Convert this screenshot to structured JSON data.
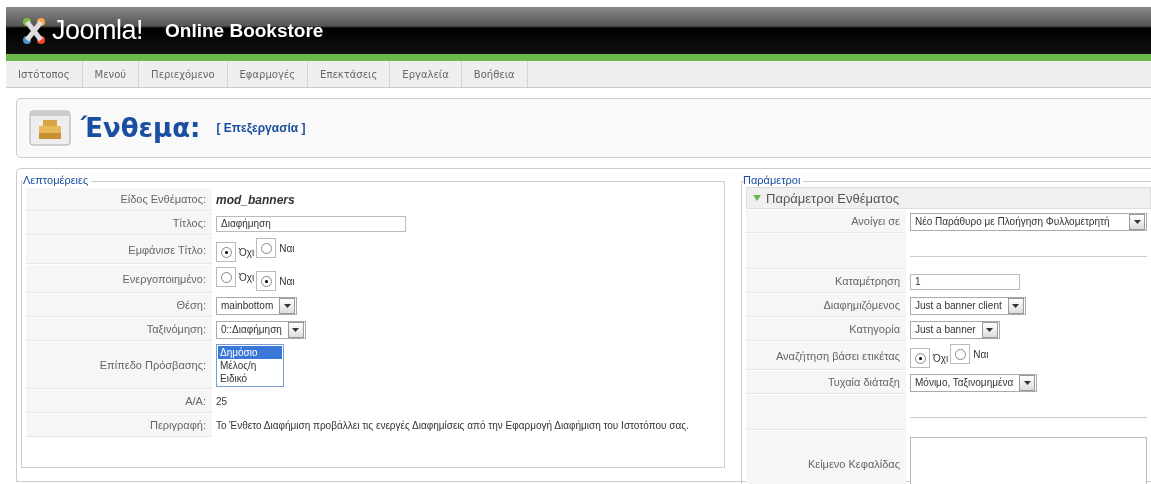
{
  "header": {
    "logo_text": "Joomla!",
    "site_name": "Online Bookstore"
  },
  "menu": [
    {
      "label": "Ιστότοπος"
    },
    {
      "label": "Μενού"
    },
    {
      "label": "Περιεχόμενο"
    },
    {
      "label": "Εφαρμογές"
    },
    {
      "label": "Επεκτάσεις"
    },
    {
      "label": "Εργαλεία"
    },
    {
      "label": "Βοήθεια"
    }
  ],
  "page_title": {
    "title": "Ένθεμα:",
    "subtitle": "[ Επεξεργασία ]"
  },
  "details": {
    "legend": "Λεπτομέρειες",
    "rows": [
      {
        "kind": "static",
        "label": "Είδος Ενθέματος:",
        "value": "mod_banners"
      },
      {
        "kind": "text",
        "label": "Τίτλος:",
        "value": "Διαφήμηση"
      },
      {
        "kind": "radio",
        "label": "Εμφάνισε Τίτλο:",
        "options": [
          {
            "label": "Όχι",
            "selected": true
          },
          {
            "label": "Ναι",
            "selected": false
          }
        ]
      },
      {
        "kind": "radio",
        "label": "Ενεργοποιημένο:",
        "options": [
          {
            "label": "Όχι",
            "selected": false
          },
          {
            "label": "Ναι",
            "selected": true
          }
        ]
      },
      {
        "kind": "select",
        "label": "Θέση:",
        "value": "mainbottom"
      },
      {
        "kind": "select",
        "label": "Ταξινόμηση:",
        "value": "0::Διαφήμηση"
      },
      {
        "kind": "list",
        "label": "Επίπεδο Πρόσβασης:",
        "options": [
          {
            "label": "Δημόσιο",
            "selected": true
          },
          {
            "label": "Μέλος/η",
            "selected": false
          },
          {
            "label": "Ειδικό",
            "selected": false
          }
        ]
      },
      {
        "kind": "plain",
        "label": "Α/Α:",
        "value": "25"
      },
      {
        "kind": "plain",
        "label": "Περιγραφή:",
        "value": "Το Ένθετο Διαφήμιση προβάλλει τις ενεργές Διαφημίσεις από την Εφαρμογή Διαφήμιση του Ιστοτόπου σας."
      }
    ]
  },
  "parameters": {
    "legend": "Παράμετροι",
    "panel_title": "Παράμετροι Ενθέματος",
    "expanded": true,
    "rows": [
      {
        "kind": "select",
        "label": "Ανοίγει σε",
        "value": "Νέο Παράθυρο με Πλοήγηση Φυλλομετρητή"
      },
      {
        "kind": "separator"
      },
      {
        "kind": "text",
        "label": "Καταμέτρηση",
        "value": "1"
      },
      {
        "kind": "select",
        "label": "Διαφημιζόμενος",
        "value": "Just a banner client"
      },
      {
        "kind": "select",
        "label": "Κατηγορία",
        "value": "Just a banner"
      },
      {
        "kind": "radio",
        "label": "Αναζήτηση βάσει ετικέτας",
        "options": [
          {
            "label": "Όχι",
            "selected": true
          },
          {
            "label": "Ναι",
            "selected": false
          }
        ]
      },
      {
        "kind": "select",
        "label": "Τυχαία διάταξη",
        "value": "Μόνιμο, Ταξινομημένα"
      },
      {
        "kind": "separator"
      },
      {
        "kind": "textarea",
        "label": "Κείμενο Κεφαλίδας"
      }
    ]
  }
}
